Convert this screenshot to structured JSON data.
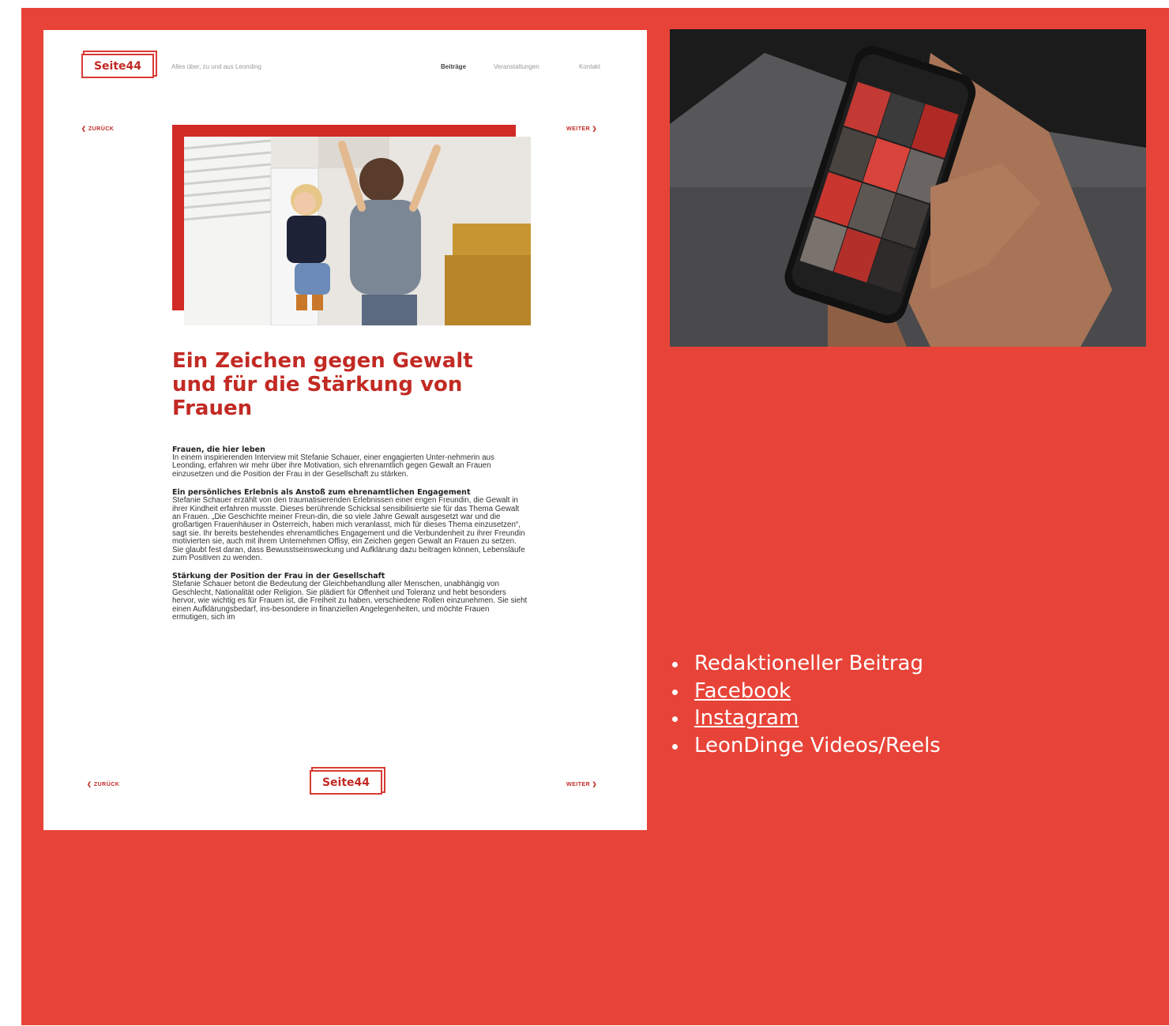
{
  "colors": {
    "background": "#e84338",
    "brand_red": "#c22a24"
  },
  "mockup": {
    "logo": "Seite44",
    "tagline": "Alles über, zu und aus Leonding",
    "nav": [
      "Beiträge",
      "Veranstaltungen",
      "Kontakt"
    ],
    "nav_active": "Beiträge",
    "back_label": "ZURÜCK",
    "next_label": "WEITER",
    "back_icon": "chevron-left-icon",
    "next_icon": "chevron-right-icon",
    "headline": "Ein Zeichen gegen Gewalt und für die Stärkung von Frauen",
    "sections": [
      {
        "heading": "Frauen, die hier leben",
        "body": "In einem inspirierenden Interview mit Stefanie Schauer, einer engagierten Unter-nehmerin aus Leonding, erfahren wir mehr über ihre Motivation, sich ehrenamtlich gegen Gewalt an Frauen einzusetzen und die Position der Frau in der Gesellschaft zu stärken."
      },
      {
        "heading": "Ein persönliches Erlebnis als Anstoß zum ehrenamtlichen Engagement",
        "body": "Stefanie Schauer erzählt von den traumatisierenden Erlebnissen einer engen Freundin, die Gewalt in ihrer Kindheit erfahren musste. Dieses berührende Schicksal sensibilisierte sie für das Thema Gewalt an Frauen. „Die Geschichte meiner Freun-din, die so viele Jahre Gewalt ausgesetzt war und die großartigen Frauenhäuser in Österreich, haben mich veranlasst, mich für dieses Thema einzusetzen“, sagt sie. Ihr bereits bestehendes ehrenamtliches Engagement und die Verbundenheit zu ihrer Freundin motivierten sie, auch mit ihrem Unternehmen Offisy, ein Zeichen gegen Gewalt an Frauen zu setzen. Sie glaubt fest daran, dass Bewusstseinsweckung und Aufklärung dazu beitragen können, Lebensläufe zum Positiven zu wenden."
      },
      {
        "heading": "Stärkung der Position der Frau in der Gesellschaft",
        "body": "Stefanie Schauer betont die Bedeutung der Gleichbehandlung aller Menschen, unabhängig von Geschlecht, Nationalität oder Religion. Sie plädiert für Offenheit und Toleranz und hebt besonders hervor, wie wichtig es für Frauen ist, die Freiheit zu haben, verschiedene Rollen einzunehmen. Sie sieht einen Aufklärungsbedarf, ins-besondere in finanziellen Angelegenheiten, und möchte Frauen ermutigen, sich im"
      }
    ]
  },
  "bullets": [
    {
      "label": "Redaktioneller Beitrag",
      "link": false
    },
    {
      "label": "Facebook",
      "link": true
    },
    {
      "label": "Instagram",
      "link": true
    },
    {
      "label": "LeonDinge Videos/Reels",
      "link": false
    }
  ]
}
